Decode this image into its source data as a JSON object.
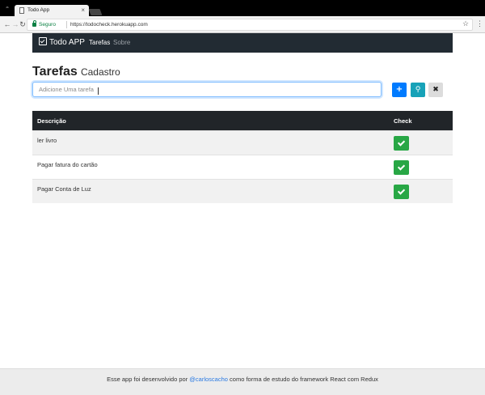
{
  "browser": {
    "tab_title": "Todo App",
    "tab_close": "×",
    "secure_label": "Seguro",
    "url": "https://todocheck.herokuapp.com"
  },
  "navbar": {
    "brand": "Todo APP",
    "links": [
      "Tarefas",
      "Sobre"
    ]
  },
  "header": {
    "title": "Tarefas",
    "subtitle": "Cadastro"
  },
  "form": {
    "placeholder": "Adicione Uma tarefa",
    "value": ""
  },
  "table": {
    "headers": [
      "Descrição",
      "Check"
    ],
    "rows": [
      {
        "description": "ler livro"
      },
      {
        "description": "Pagar fatura do cartão"
      },
      {
        "description": "Pagar Conta de Luz"
      }
    ]
  },
  "footer": {
    "prefix": "Esse app foi desenvolvido por",
    "author": "@carloscacho",
    "suffix": "como forma de estudo do framework React com Redux"
  },
  "colors": {
    "navbar": "#222b33",
    "add": "#007bff",
    "search": "#17a2b8",
    "clear": "#dcdcdc",
    "check": "#28a745"
  }
}
